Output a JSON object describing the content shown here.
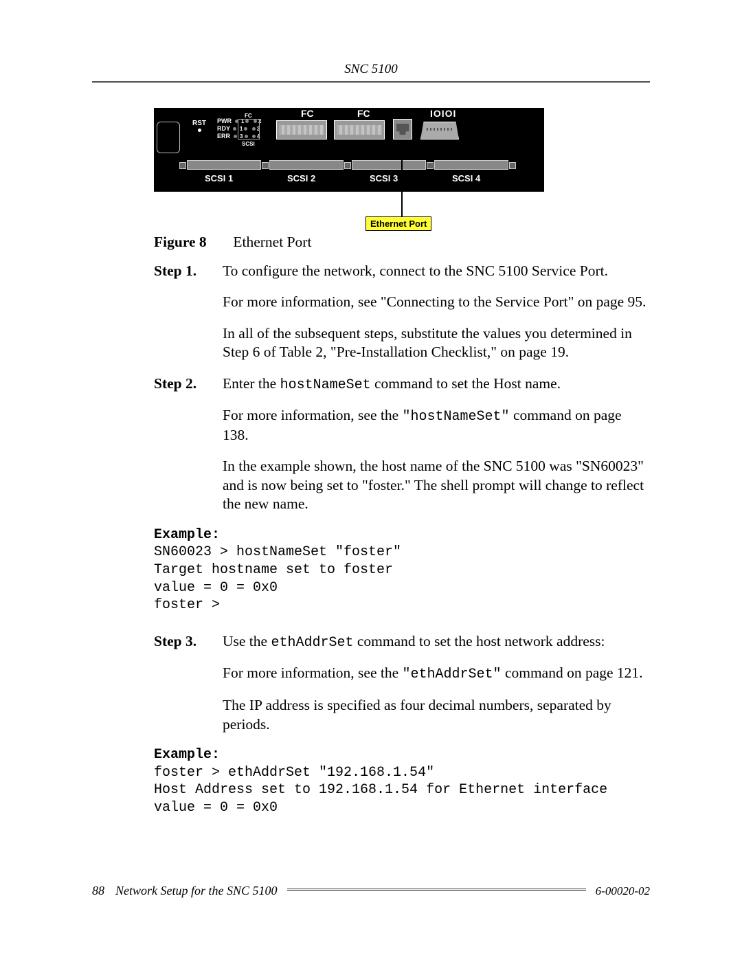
{
  "header": {
    "product": "SNC 5100"
  },
  "device": {
    "rst": "RST",
    "leds": {
      "pwr": "PWR",
      "rdy": "RDY",
      "err": "ERR",
      "fc": "FC",
      "scsi": "SCSI"
    },
    "top": {
      "fc1": "FC 1",
      "fc2": "FC 2",
      "ioioi": "IOIOI"
    },
    "scsi": {
      "s1": "SCSI 1",
      "s2": "SCSI 2",
      "s3": "SCSI 3",
      "s4": "SCSI 4"
    },
    "callout": "Ethernet Port"
  },
  "figure": {
    "label": "Figure 8",
    "caption": "Ethernet Port"
  },
  "step1": {
    "label": "Step 1.",
    "p1": "To configure the network, connect to the SNC 5100 Service Port.",
    "p2": "For more information, see \"Connecting to the Service Port\" on page 95.",
    "p3": "In all of the subsequent steps, substitute the values you determined in Step 6 of Table 2, \"Pre-Installation Checklist,\" on page 19."
  },
  "step2": {
    "label": "Step 2.",
    "p1a": "Enter the ",
    "cmd1": "hostNameSet",
    "p1b": " command to set the Host name.",
    "p2a": "For more information, see the ",
    "cmd2": "\"hostNameSet\"",
    "p2b": " command on page 138.",
    "p3": "In the example shown, the host name of the SNC 5100 was \"SN60023\" and is now being set to \"foster.\" The shell prompt will change to reflect the new name."
  },
  "example1": {
    "head": "Example:",
    "body": "SN60023 > hostNameSet \"foster\"\nTarget hostname set to foster\nvalue = 0 = 0x0\nfoster >"
  },
  "step3": {
    "label": "Step 3.",
    "p1a": "Use the ",
    "cmd1": "ethAddrSet",
    "p1b": " command to set the host network address:",
    "p2a": "For more information, see the ",
    "cmd2": "\"ethAddrSet\"",
    "p2b": " command on page 121.",
    "p3": "The IP address is specified as four decimal numbers, separated by periods."
  },
  "example2": {
    "head": "Example:",
    "body": "foster > ethAddrSet \"192.168.1.54\"\nHost Address set to 192.168.1.54 for Ethernet interface\nvalue = 0 = 0x0"
  },
  "footer": {
    "page": "88",
    "section": "Network Setup for the SNC 5100",
    "docnum": "6-00020-02"
  }
}
